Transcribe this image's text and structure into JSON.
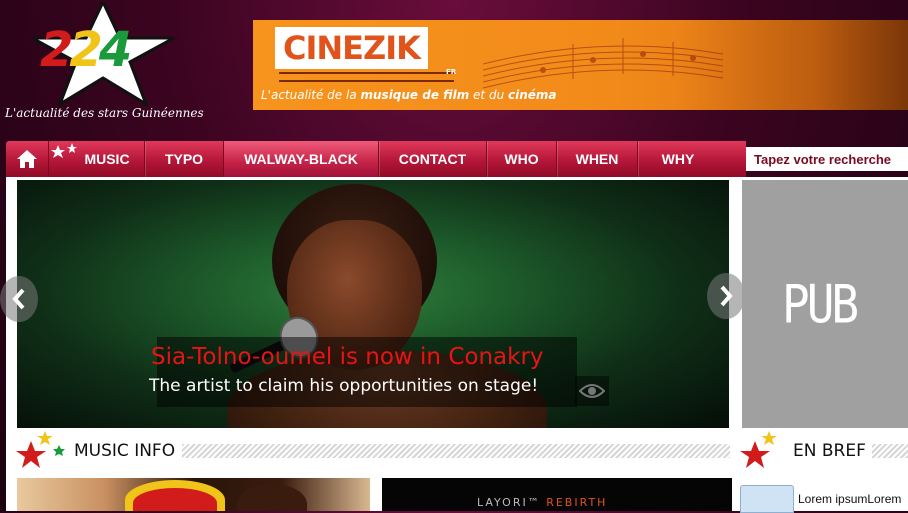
{
  "logo": {
    "number": [
      "2",
      "2",
      "4"
    ],
    "tagline": "L'actualité des stars Guinéennes"
  },
  "banner": {
    "brand": "CINEZIK",
    "brand_suffix": "FR",
    "tagline_parts": [
      "L'actualité de la ",
      "musique de film",
      " et du ",
      "cinéma"
    ]
  },
  "nav": {
    "items": [
      "MUSIC",
      "TYPO",
      "WALWAY-BLACK",
      "CONTACT",
      "WHO",
      "WHEN",
      "WHY"
    ],
    "active": "WALWAY-BLACK"
  },
  "search": {
    "placeholder": "Tapez votre recherche"
  },
  "slider": {
    "title": "Sia-Tolno-oumel is now in Conakry",
    "subtitle": "The artist to claim his opportunities on stage!"
  },
  "pub": {
    "label": "PUB"
  },
  "sections": {
    "music_info": "MUSIC INFO",
    "en_bref": "EN BREF"
  },
  "thumb2": {
    "text_left": "LAYORI™",
    "text_right": " REBIRTH"
  },
  "brief": {
    "text": "Lorem ipsumLorem"
  },
  "colors": {
    "nav_red": "#b01436",
    "accent_orange": "#f7941d",
    "caption_red": "#e81414"
  }
}
